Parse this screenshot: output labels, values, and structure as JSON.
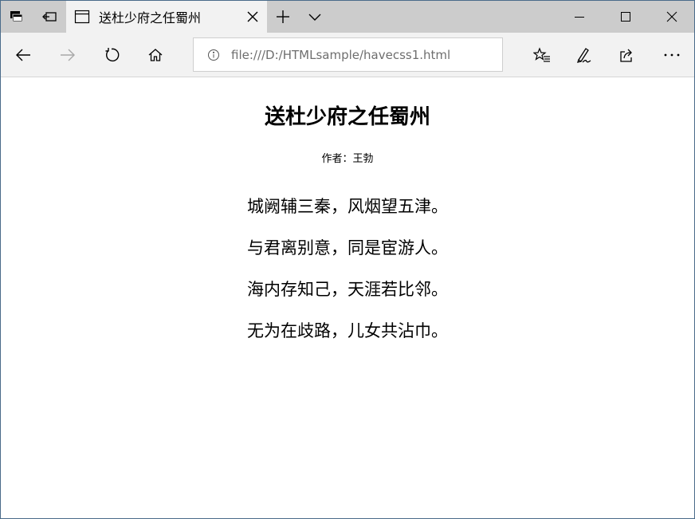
{
  "tab": {
    "title": "送杜少府之任蜀州"
  },
  "address": {
    "url": "file:///D:/HTMLsample/havecss1.html"
  },
  "page": {
    "title": "送杜少府之任蜀州",
    "author": "作者：王勃",
    "lines": [
      "城阙辅三秦，风烟望五津。",
      "与君离别意，同是宦游人。",
      "海内存知己，天涯若比邻。",
      "无为在歧路，儿女共沾巾。"
    ]
  },
  "icons": {
    "tabstrip": [
      "tab-set-aside-icon",
      "tab-preview-icon",
      "page-tab-icon",
      "close-icon",
      "new-tab-plus-icon",
      "chevron-down-icon"
    ],
    "window": [
      "minimize-icon",
      "maximize-icon",
      "close-icon"
    ],
    "nav": [
      "back-arrow-icon",
      "forward-arrow-icon",
      "refresh-icon",
      "home-icon",
      "info-icon",
      "favorites-star-icon",
      "pen-icon",
      "share-icon",
      "more-dots-icon"
    ]
  }
}
